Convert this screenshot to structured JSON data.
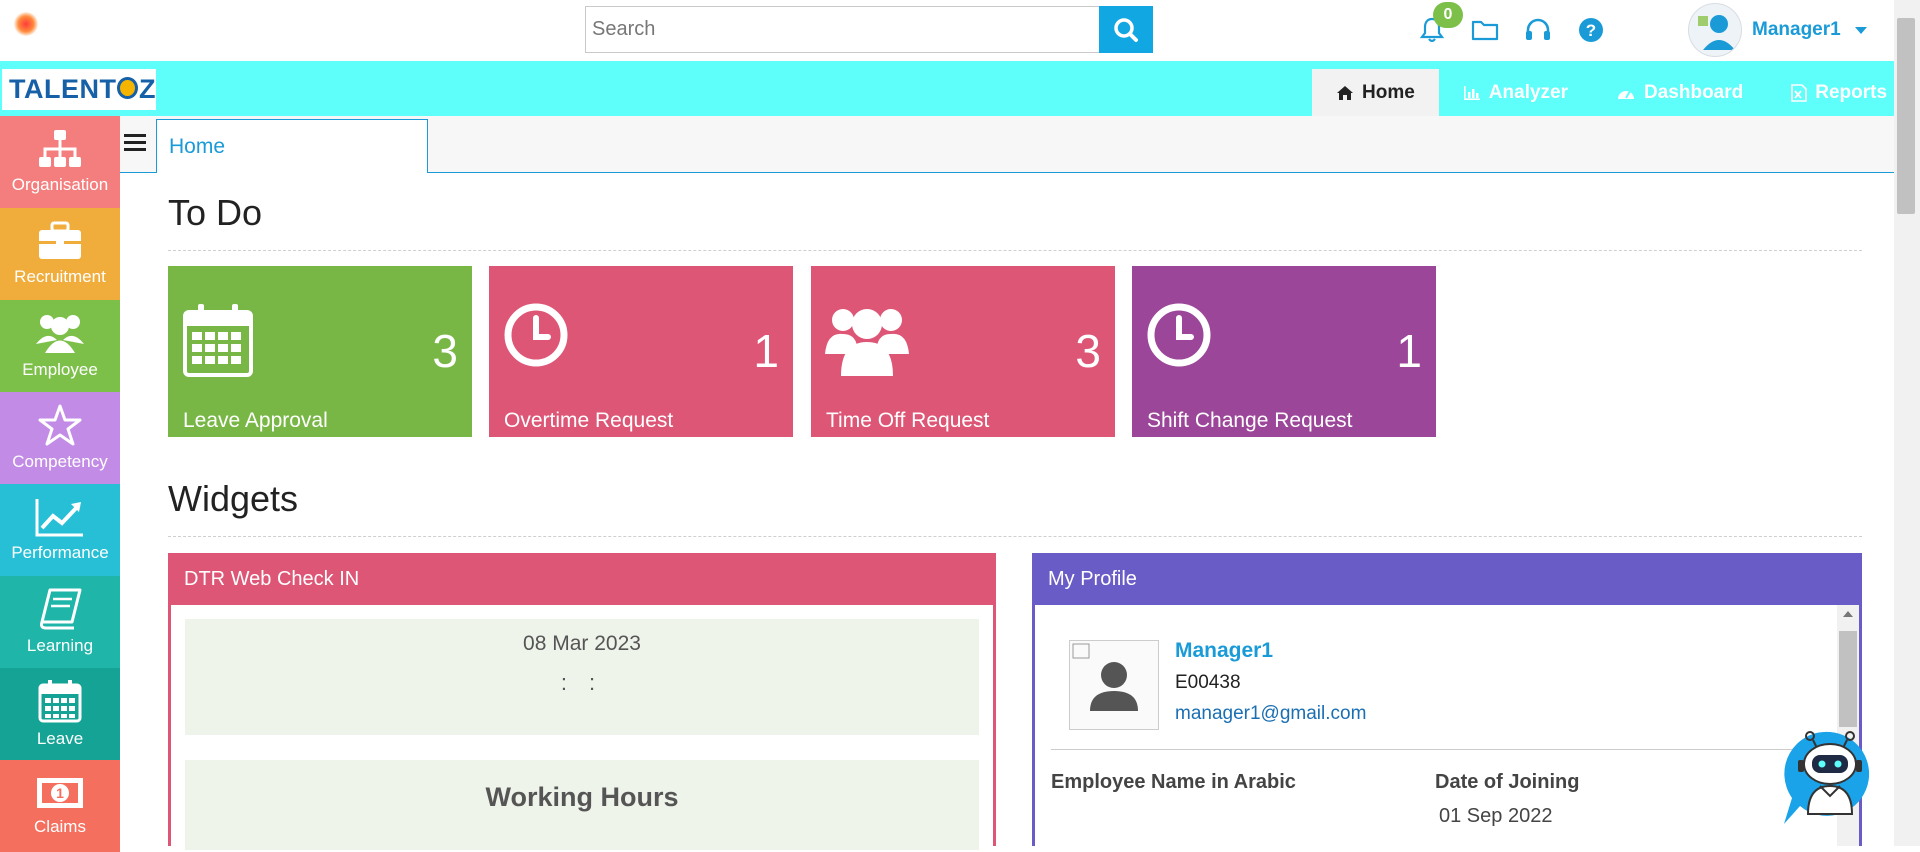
{
  "search": {
    "placeholder": "Search"
  },
  "notifications": {
    "count": "0"
  },
  "user": {
    "name": "Manager1"
  },
  "brand": {
    "name_prefix": "TALENT",
    "name_suffix": "Z"
  },
  "nav": {
    "tabs": [
      {
        "label": "Home",
        "icon": "home-icon",
        "active": true
      },
      {
        "label": "Analyzer",
        "icon": "bar-chart-icon"
      },
      {
        "label": "Dashboard",
        "icon": "dashboard-icon"
      },
      {
        "label": "Reports",
        "icon": "excel-icon"
      }
    ]
  },
  "sidebar": {
    "items": [
      {
        "label": "Organisation",
        "color": "#f47e7e",
        "icon": "org-chart-icon"
      },
      {
        "label": "Recruitment",
        "color": "#f0ad3c",
        "icon": "briefcase-icon"
      },
      {
        "label": "Employee",
        "color": "#7cc04a",
        "icon": "users-icon"
      },
      {
        "label": "Competency",
        "color": "#c28be6",
        "icon": "star-icon"
      },
      {
        "label": "Performance",
        "color": "#26bfd6",
        "icon": "line-chart-icon"
      },
      {
        "label": "Learning",
        "color": "#1fb5a8",
        "icon": "book-icon"
      },
      {
        "label": "Leave",
        "color": "#14a394",
        "icon": "calendar-icon"
      },
      {
        "label": "Claims",
        "color": "#f46f5e",
        "icon": "money-icon"
      }
    ]
  },
  "tabstrip": {
    "home_tab": "Home"
  },
  "todo": {
    "title": "To Do",
    "cards": [
      {
        "label": "Leave Approval",
        "count": "3",
        "color": "#78b745",
        "icon": "calendar-icon"
      },
      {
        "label": "Overtime Request",
        "count": "1",
        "color": "#de5676",
        "icon": "clock-icon"
      },
      {
        "label": "Time Off Request",
        "count": "3",
        "color": "#de5676",
        "icon": "users-icon"
      },
      {
        "label": "Shift Change Request",
        "count": "1",
        "color": "#9b4699",
        "icon": "clock-icon"
      }
    ]
  },
  "widgets": {
    "title": "Widgets",
    "dtr": {
      "title": "DTR Web Check IN",
      "date": "08 Mar 2023",
      "time": ": :",
      "working_hours": "Working Hours",
      "color": "#de5676"
    },
    "profile": {
      "title": "My Profile",
      "name": "Manager1",
      "code": "E00438",
      "email": "manager1@gmail.com",
      "label_arabic": "Employee Name in Arabic",
      "label_doj": "Date of Joining",
      "doj": "01 Sep 2022",
      "color": "#6a5cc7"
    }
  }
}
